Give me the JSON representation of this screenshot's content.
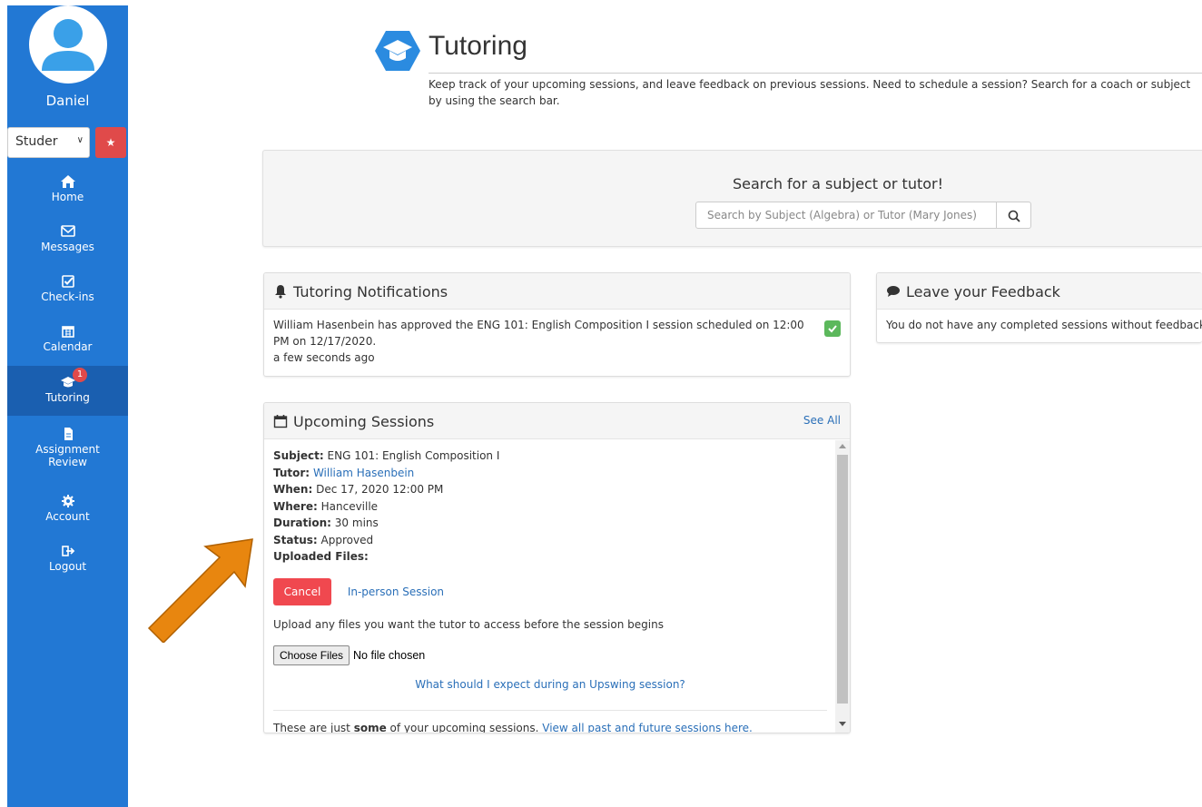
{
  "sidebar": {
    "username": "Daniel",
    "role_select_value": "Studer",
    "nav": [
      {
        "label": "Home",
        "icon": "home-icon"
      },
      {
        "label": "Messages",
        "icon": "envelope-icon"
      },
      {
        "label": "Check-ins",
        "icon": "check-square-icon"
      },
      {
        "label": "Calendar",
        "icon": "calendar-icon"
      },
      {
        "label": "Tutoring",
        "icon": "graduation-cap-icon",
        "badge": "1",
        "active": true
      },
      {
        "label": "Assignment Review",
        "label_line1": "Assignment",
        "label_line2": "Review",
        "icon": "file-icon"
      },
      {
        "label": "Account",
        "icon": "gear-icon"
      },
      {
        "label": "Logout",
        "icon": "logout-icon"
      }
    ],
    "colors": {
      "bg": "#2278d4",
      "active": "#1a5fb0",
      "star": "#e04a4a"
    }
  },
  "header": {
    "title": "Tutoring",
    "description": "Keep track of your upcoming sessions, and leave feedback on previous sessions. Need to schedule a session? Search for a coach or subject by using the search bar."
  },
  "search": {
    "heading": "Search for a subject or tutor!",
    "placeholder": "Search by Subject (Algebra) or Tutor (Mary Jones)"
  },
  "notifications": {
    "title": "Tutoring Notifications",
    "message": "William Hasenbein has approved the ENG 101: English Composition I session scheduled on 12:00 PM on 12/17/2020.",
    "time": "a few seconds ago"
  },
  "feedback": {
    "title": "Leave your Feedback",
    "message": "You do not have any completed sessions without feedback"
  },
  "sessions": {
    "title": "Upcoming Sessions",
    "see_all": "See All",
    "subject_label": "Subject:",
    "subject": "ENG 101: English Composition I",
    "tutor_label": "Tutor:",
    "tutor": "William Hasenbein",
    "when_label": "When:",
    "when": "Dec 17, 2020 12:00 PM",
    "where_label": "Where:",
    "where": "Hanceville",
    "duration_label": "Duration:",
    "duration": "30 mins",
    "status_label": "Status:",
    "status": "Approved",
    "files_label": "Uploaded Files:",
    "cancel": "Cancel",
    "session_type": "In-person Session",
    "upload_text": "Upload any files you want the tutor to access before the session begins",
    "choose_files": "Choose Files",
    "no_file": "No file chosen",
    "expect_link": "What should I expect during an Upswing session?",
    "foot_pre": "These are just ",
    "foot_bold": "some",
    "foot_mid": " of your upcoming sessions. ",
    "foot_link": "View all past and future sessions here."
  },
  "colors": {
    "accent_link": "#2a6fb8",
    "cancel_red": "#f0484f",
    "check_green": "#5cb85c",
    "arrow_orange": "#e8860f"
  }
}
